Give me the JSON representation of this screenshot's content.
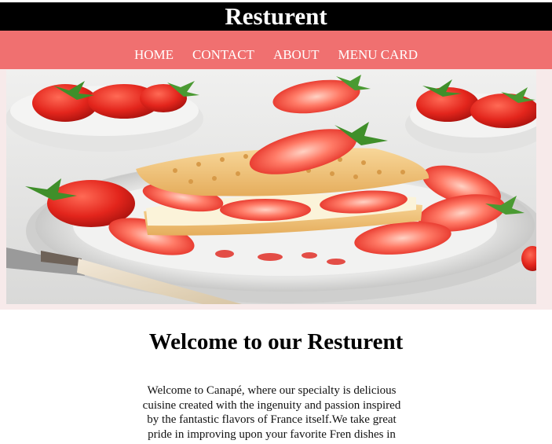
{
  "header": {
    "site_title": "Resturent"
  },
  "nav": {
    "items": [
      {
        "label": "HOME"
      },
      {
        "label": "CONTACT"
      },
      {
        "label": "ABOUT"
      },
      {
        "label": "MENU CARD"
      }
    ]
  },
  "hero": {
    "image_icon": "strawberry-biscuit-photo"
  },
  "welcome": {
    "heading": "Welcome to our Resturent",
    "intro_text": "Welcome to Canapé, where our specialty is delicious cuisine created with the ingenuity and passion inspired by the fantastic flavors of France itself.We take great pride in improving upon your favorite Fren dishes in new and creative"
  },
  "colors": {
    "title_bar_bg": "#000000",
    "nav_bg": "#f07070",
    "nav_text": "#ffffff",
    "hero_frame": "#f7eaea"
  }
}
